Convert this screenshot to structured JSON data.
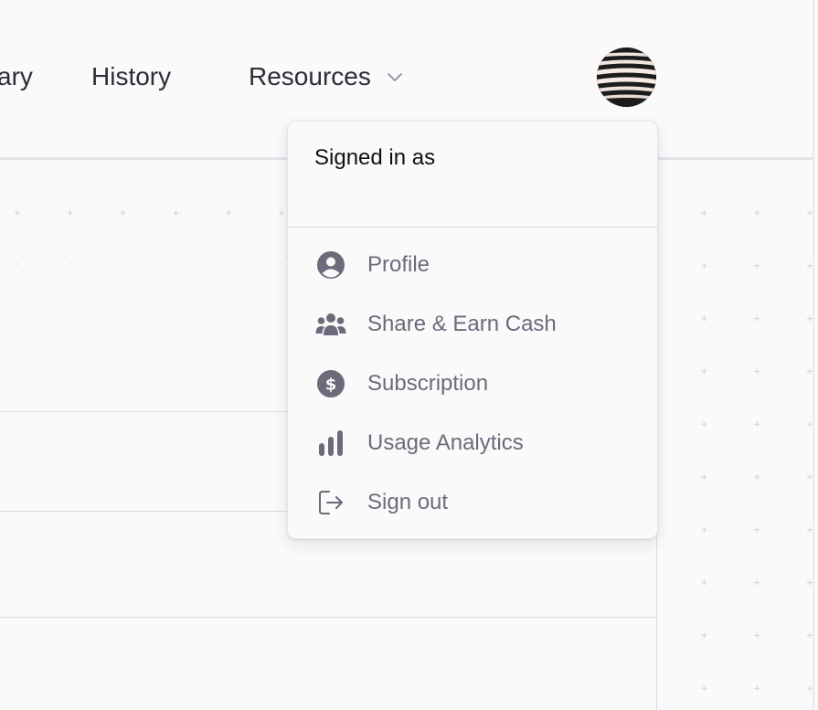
{
  "nav": {
    "library_label": "ary",
    "history_label": "History",
    "resources_label": "Resources",
    "resources_icon": "chevron-down-icon",
    "avatar_icon": "avatar"
  },
  "dropdown": {
    "signed_in_label": "Signed in as",
    "items": [
      {
        "label": "Profile",
        "icon": "user-circle-icon"
      },
      {
        "label": "Share & Earn Cash",
        "icon": "users-group-icon"
      },
      {
        "label": "Subscription",
        "icon": "dollar-circle-icon"
      },
      {
        "label": "Usage Analytics",
        "icon": "bar-chart-icon"
      },
      {
        "label": "Sign out",
        "icon": "sign-out-icon"
      }
    ]
  },
  "colors": {
    "text_dark": "#2d2d3a",
    "menu_text": "#6b6b7b",
    "icon": "#6b6b7b",
    "background": "#fafafa"
  }
}
